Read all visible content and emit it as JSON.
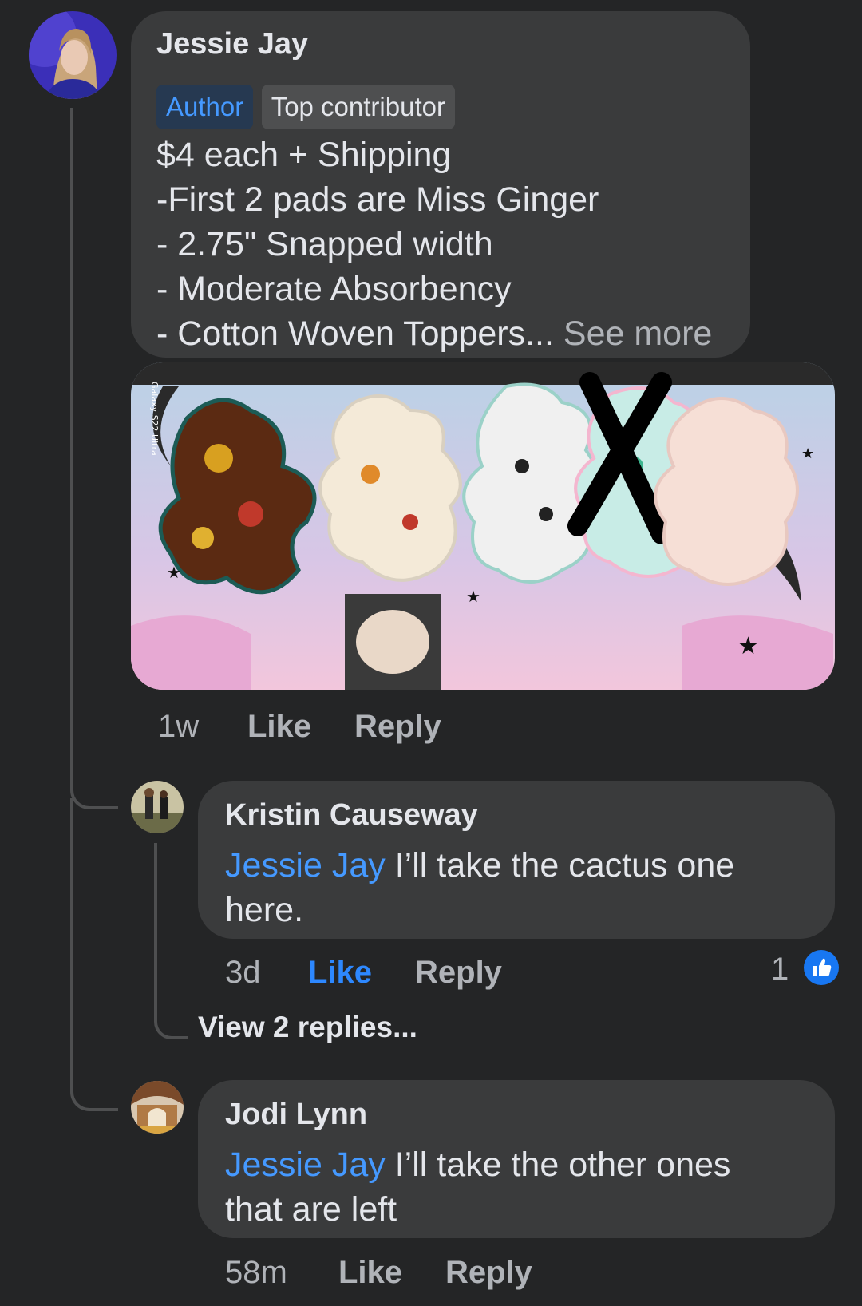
{
  "comment_main": {
    "author": "Jessie Jay",
    "badges": [
      "Author",
      "Top contributor"
    ],
    "lines": [
      "$4 each + Shipping",
      "-First 2 pads are Miss Ginger",
      "- 2.75\" Snapped width",
      "- Moderate Absorbency",
      "- Cotton Woven Toppers..."
    ],
    "see_more": "See more",
    "photo_watermark": "Galaxy S22 Ultra",
    "time": "1w",
    "like": "Like",
    "reply": "Reply"
  },
  "reply_1": {
    "author": "Kristin Causeway",
    "mention": "Jessie Jay",
    "text_line1": "I’ll take the cactus one",
    "text_line2": "here.",
    "time": "3d",
    "like": "Like",
    "reply": "Reply",
    "like_count": "1",
    "view_replies": "View 2 replies..."
  },
  "reply_2": {
    "author": "Jodi Lynn",
    "mention": "Jessie Jay",
    "text_line1": "I’ll take the other ones",
    "text_line2": "that are left",
    "time": "58m",
    "like": "Like",
    "reply": "Reply"
  },
  "colors": {
    "background": "#242526",
    "bubble": "#3a3b3c",
    "mention": "#4599ff",
    "like_active": "#2d88ff"
  },
  "icons": [
    "thumbs-up-icon"
  ]
}
